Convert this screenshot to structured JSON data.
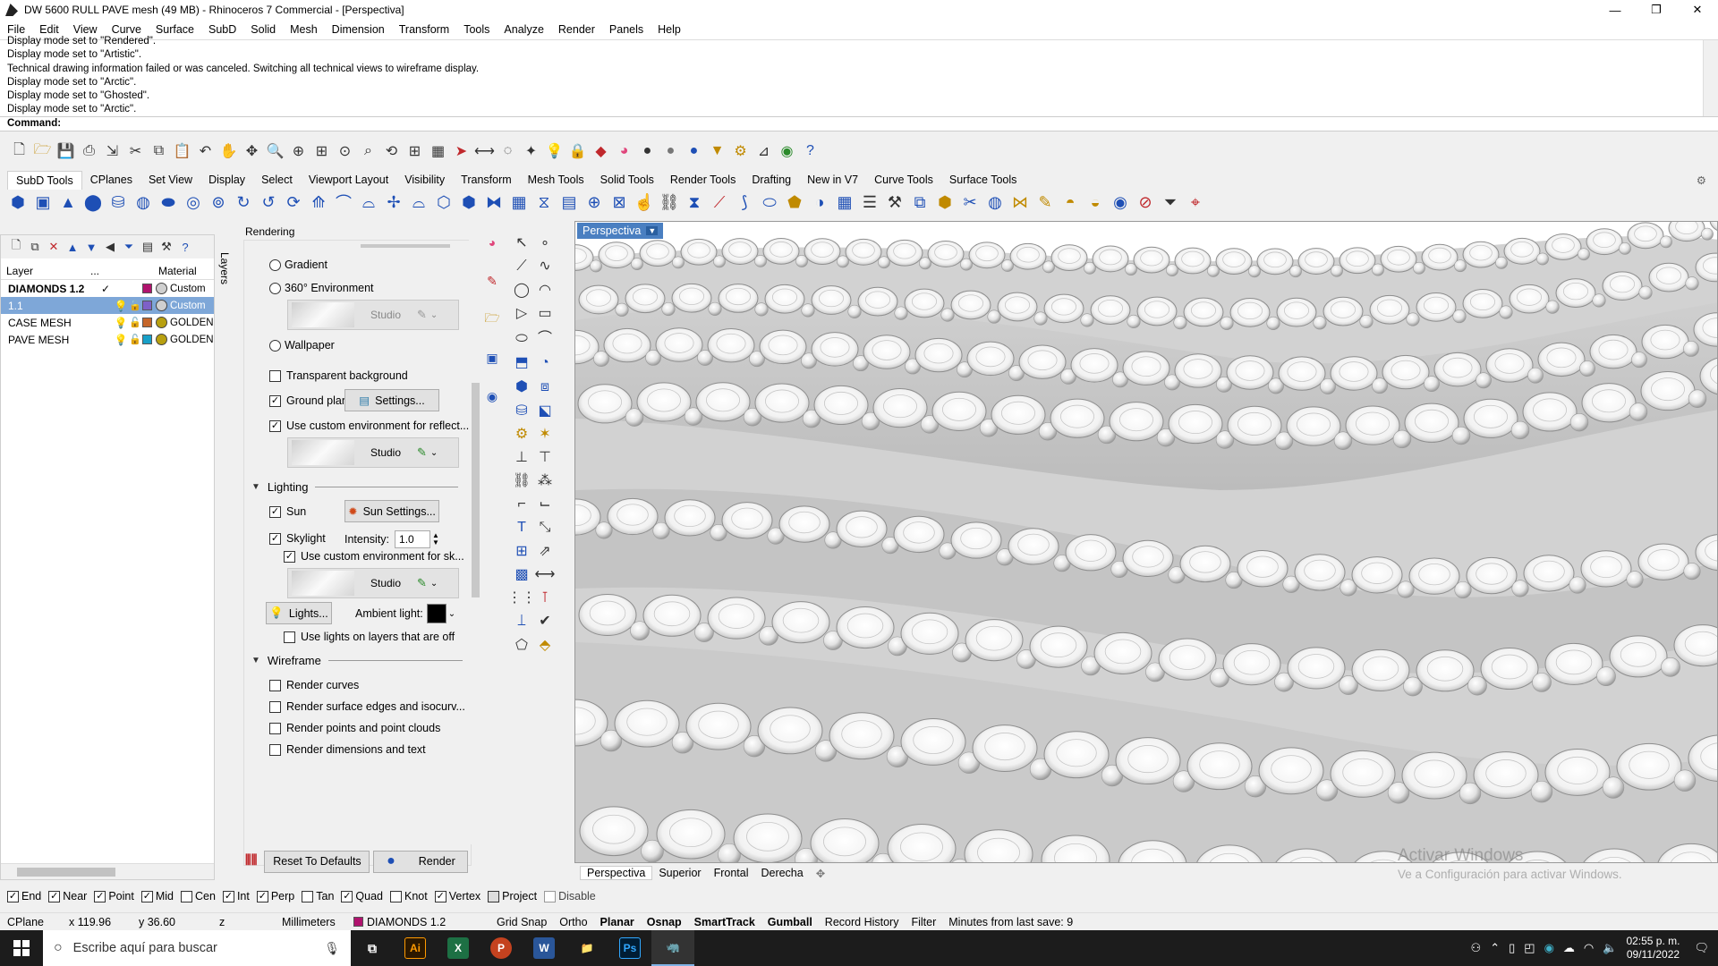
{
  "window": {
    "title": "DW 5600 RULL PAVE mesh (49 MB) - Rhinoceros 7 Commercial - [Perspectiva]",
    "minimize": "—",
    "maximize": "❐",
    "close": "✕"
  },
  "menu": [
    "File",
    "Edit",
    "View",
    "Curve",
    "Surface",
    "SubD",
    "Solid",
    "Mesh",
    "Dimension",
    "Transform",
    "Tools",
    "Analyze",
    "Render",
    "Panels",
    "Help"
  ],
  "command_history": [
    "Display mode set to \"Rendered\".",
    "Display mode set to \"Artistic\".",
    "Technical drawing information failed or was canceled. Switching all technical views to wireframe display.",
    "Display mode set to \"Arctic\".",
    "Display mode set to \"Ghosted\".",
    "Display mode set to \"Arctic\"."
  ],
  "command_prompt": "Command:",
  "toolbar_tabs": [
    "SubD Tools",
    "CPlanes",
    "Set View",
    "Display",
    "Select",
    "Viewport Layout",
    "Visibility",
    "Transform",
    "Mesh Tools",
    "Solid Tools",
    "Render Tools",
    "Drafting",
    "New in V7",
    "Curve Tools",
    "Surface Tools"
  ],
  "layers": {
    "tab_label": "Layers",
    "col_layer": "Layer",
    "col_dots": "...",
    "col_material": "Material",
    "rows": [
      {
        "name": "DIAMONDS 1.2",
        "mark": "✓",
        "color": "#b0136e",
        "mat_color": "#cfcfcf",
        "material": "Custom"
      },
      {
        "name": "1.1",
        "mark": "",
        "color": "#7e60c8",
        "mat_color": "#cfcfcf",
        "material": "Custom"
      },
      {
        "name": "CASE MESH",
        "mark": "",
        "color": "#c5662a",
        "mat_color": "#b8a010",
        "material": "GOLDEN"
      },
      {
        "name": "PAVE MESH",
        "mark": "",
        "color": "#18a0c8",
        "mat_color": "#b8a010",
        "material": "GOLDEN"
      }
    ]
  },
  "rendering": {
    "title": "Rendering",
    "gradient": "Gradient",
    "env360": "360° Environment",
    "studio": "Studio",
    "wallpaper": "Wallpaper",
    "transparent_bg": "Transparent background",
    "ground_plane": "Ground plane",
    "settings": "Settings...",
    "custom_env_reflect": "Use custom environment for reflect...",
    "lighting": "Lighting",
    "sun": "Sun",
    "sun_settings": "Sun Settings...",
    "skylight": "Skylight",
    "intensity_label": "Intensity:",
    "intensity_value": "1.0",
    "custom_env_sky": "Use custom environment for sk...",
    "lights_btn": "Lights...",
    "ambient_label": "Ambient light:",
    "use_lights_layers": "Use lights on layers that are off",
    "wireframe": "Wireframe",
    "render_curves": "Render curves",
    "render_surface_edges": "Render surface edges and isocurv...",
    "render_points": "Render points and point clouds",
    "render_dimensions": "Render dimensions and text",
    "reset_defaults": "Reset To Defaults",
    "render": "Render"
  },
  "viewport": {
    "label": "Perspectiva",
    "tabs": [
      "Perspectiva",
      "Superior",
      "Frontal",
      "Derecha"
    ],
    "watermark_1": "Activar Windows",
    "watermark_2": "Ve a Configuración para activar Windows."
  },
  "osnaps": [
    {
      "label": "End",
      "on": true
    },
    {
      "label": "Near",
      "on": true
    },
    {
      "label": "Point",
      "on": true
    },
    {
      "label": "Mid",
      "on": true
    },
    {
      "label": "Cen",
      "on": false
    },
    {
      "label": "Int",
      "on": true
    },
    {
      "label": "Perp",
      "on": true
    },
    {
      "label": "Tan",
      "on": false
    },
    {
      "label": "Quad",
      "on": true
    },
    {
      "label": "Knot",
      "on": false
    },
    {
      "label": "Vertex",
      "on": true
    },
    {
      "label": "Project",
      "on": false
    },
    {
      "label": "Disable",
      "on": false
    }
  ],
  "status": {
    "cplane": "CPlane",
    "x": "x 119.96",
    "y": "y 36.60",
    "z": "z",
    "units": "Millimeters",
    "layer": "DIAMONDS 1.2",
    "grid_snap": "Grid Snap",
    "ortho": "Ortho",
    "planar": "Planar",
    "osnap": "Osnap",
    "smarttrack": "SmartTrack",
    "gumball": "Gumball",
    "record_history": "Record History",
    "filter": "Filter",
    "autosave": "Minutes from last save: 9"
  },
  "taskbar": {
    "search_placeholder": "Escribe aquí para buscar",
    "apps": [
      "Ai",
      "X",
      "P",
      "W",
      "📁",
      "Ps",
      "🦏"
    ],
    "time": "02:55 p. m.",
    "date": "09/11/2022"
  }
}
